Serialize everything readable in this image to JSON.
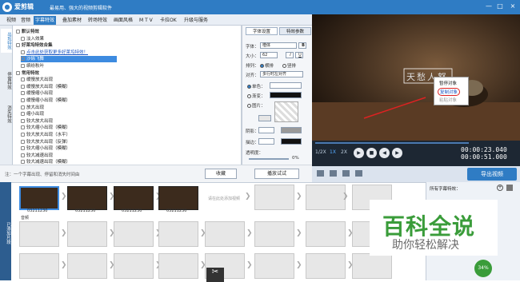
{
  "title_bar": {
    "app_name": "爱剪辑",
    "slogan": "最易用、强大的视频剪辑软件"
  },
  "menu": [
    "视频",
    "音频",
    "字幕特效",
    "叠加素材",
    "转场特效",
    "画面风格",
    "M T V",
    "卡拉OK",
    "升级与服务"
  ],
  "menu_active": 2,
  "side_tabs": [
    "出现特效",
    "停留特效",
    "消失特效"
  ],
  "effects": {
    "rows": [
      {
        "text": "默认特效",
        "type": "group"
      },
      {
        "text": "淡入效果",
        "type": "item"
      },
      {
        "text": "好莱坞特效合集",
        "type": "group"
      },
      {
        "text": "点击此处获取更多好莱坞特效！",
        "type": "link"
      },
      {
        "text": "沙砾飞舞",
        "type": "sel"
      },
      {
        "text": "缤纷秋叶",
        "type": "item"
      },
      {
        "text": "常用特效",
        "type": "group"
      },
      {
        "text": "缓慢放大出现",
        "type": "item"
      },
      {
        "text": "缓慢放大出现（模糊）",
        "type": "item"
      },
      {
        "text": "缓慢缩小出现",
        "type": "item"
      },
      {
        "text": "缓慢缩小出现（模糊）",
        "type": "item"
      },
      {
        "text": "放大出现",
        "type": "item"
      },
      {
        "text": "缩小出现",
        "type": "item"
      },
      {
        "text": "较大放大出现",
        "type": "item"
      },
      {
        "text": "较大缩小出现（模糊）",
        "type": "item"
      },
      {
        "text": "较大放大出现（水平）",
        "type": "item"
      },
      {
        "text": "较大放大出现（反弹）",
        "type": "item"
      },
      {
        "text": "较大缩小出现（模糊）",
        "type": "item"
      },
      {
        "text": "较大减速出现",
        "type": "item"
      },
      {
        "text": "较大减速出现（模糊）",
        "type": "item"
      },
      {
        "text": "较大减速出现（放大）",
        "type": "item"
      }
    ]
  },
  "note": {
    "text": "注：一个字幕出现、停留和消失时间由",
    "collect_label": "收藏",
    "play_label": "播放试试"
  },
  "props": {
    "tab_font": "字体设置",
    "tab_effect": "特效参数",
    "font_label": "字体：",
    "font_value": "楷体",
    "size_label": "大小：",
    "size_value": "62",
    "arrange_label": "排列：",
    "arrange_h": "横排",
    "arrange_v": "竖排",
    "align_label": "对齐：",
    "align_value": "多行时左对齐",
    "color_label": "单色：",
    "grad_label": "渐变：",
    "image_label": "图片：",
    "shadow_label": "阴影：",
    "stroke_label": "描边：",
    "opacity_label": "透明度：",
    "opacity_value": "0%"
  },
  "preview": {
    "caption": "天愁人怒",
    "context_menu": [
      "暂停对象",
      "复制对象",
      "粘贴对象"
    ],
    "time_current": "00:00:23.040",
    "time_total": "00:00:51.000",
    "speeds": [
      "1/2X",
      "1X",
      "2X"
    ],
    "export_label": "导出视频"
  },
  "timeline": {
    "side_label": "已添加片段",
    "clip_label": "03211230",
    "hint": "请在此处添加视频",
    "track_label": "音频"
  },
  "subtitle_panel": {
    "title": "所有字幕特效："
  },
  "watermark": {
    "line1": "百科全说",
    "line2": "助你轻松解决"
  },
  "progress": {
    "percent": "34%"
  },
  "colors": {
    "accent": "#2f7cc4",
    "selection": "#3d8be0",
    "watermark_green": "#3a9c3a"
  }
}
